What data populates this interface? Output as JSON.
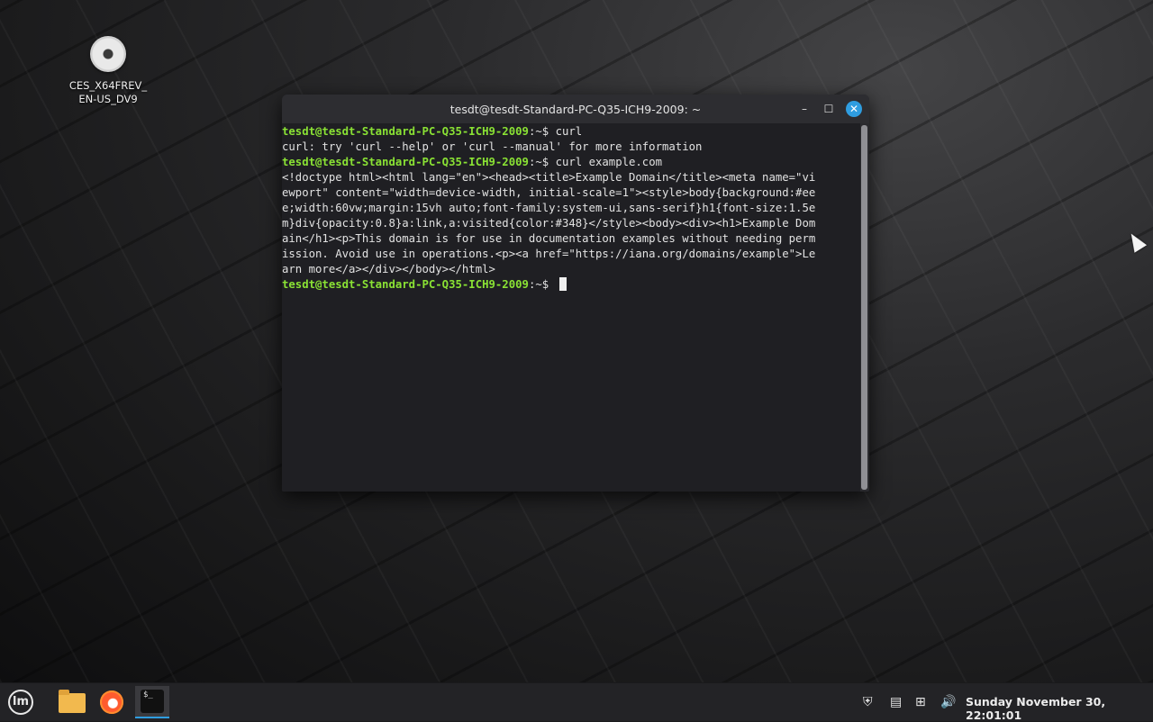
{
  "desktop": {
    "icon_label_line1": "CES_X64FREV_",
    "icon_label_line2": "EN-US_DV9"
  },
  "terminal": {
    "title": "tesdt@tesdt-Standard-PC-Q35-ICH9-2009: ~",
    "lines": [
      {
        "prompt": "tesdt@tesdt-Standard-PC-Q35-ICH9-2009",
        "suffix": ":~$ ",
        "text": "curl"
      },
      {
        "prompt": "",
        "suffix": "",
        "text": "curl: try 'curl --help' or 'curl --manual' for more information"
      },
      {
        "prompt": "tesdt@tesdt-Standard-PC-Q35-ICH9-2009",
        "suffix": ":~$ ",
        "text": "curl example.com"
      },
      {
        "prompt": "",
        "suffix": "",
        "text": "<!doctype html><html lang=\"en\"><head><title>Example Domain</title><meta name=\"vi"
      },
      {
        "prompt": "",
        "suffix": "",
        "text": "ewport\" content=\"width=device-width, initial-scale=1\"><style>body{background:#ee"
      },
      {
        "prompt": "",
        "suffix": "",
        "text": "e;width:60vw;margin:15vh auto;font-family:system-ui,sans-serif}h1{font-size:1.5e"
      },
      {
        "prompt": "",
        "suffix": "",
        "text": "m}div{opacity:0.8}a:link,a:visited{color:#348}</style><body><div><h1>Example Dom"
      },
      {
        "prompt": "",
        "suffix": "",
        "text": "ain</h1><p>This domain is for use in documentation examples without needing perm"
      },
      {
        "prompt": "",
        "suffix": "",
        "text": "ission. Avoid use in operations.<p><a href=\"https://iana.org/domains/example\">Le"
      },
      {
        "prompt": "",
        "suffix": "",
        "text": "arn more</a></div></body></html>"
      },
      {
        "prompt": "tesdt@tesdt-Standard-PC-Q35-ICH9-2009",
        "suffix": ":~$ ",
        "text": ""
      }
    ],
    "minimize_glyph": "–",
    "maximize_glyph": "☐",
    "close_glyph": "✕"
  },
  "taskbar": {
    "menu_glyph": "lm",
    "terminal_glyph": "$_",
    "clock": "Sunday November 30, 22:01:01"
  },
  "icons": {
    "shield": "⛨",
    "note": "▤",
    "network": "⊞",
    "volume": "🔊"
  }
}
